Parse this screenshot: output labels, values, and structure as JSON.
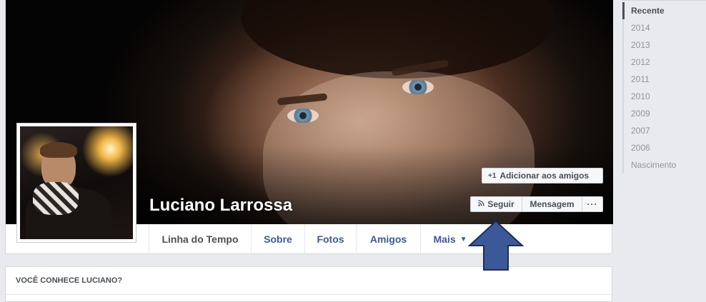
{
  "profile": {
    "name": "Luciano Larrossa"
  },
  "actions": {
    "add_friend": "Adicionar aos amigos",
    "follow": "Seguir",
    "message": "Mensagem",
    "more": "···"
  },
  "tabs": [
    {
      "label": "Linha do Tempo",
      "active": true
    },
    {
      "label": "Sobre"
    },
    {
      "label": "Fotos"
    },
    {
      "label": "Amigos"
    },
    {
      "label": "Mais"
    }
  ],
  "section": {
    "title": "VOCÊ CONHECE LUCIANO?"
  },
  "timeline_nav": {
    "items": [
      {
        "label": "Recente",
        "active": true
      },
      {
        "label": "2014"
      },
      {
        "label": "2013"
      },
      {
        "label": "2012"
      },
      {
        "label": "2011"
      },
      {
        "label": "2010"
      },
      {
        "label": "2009"
      },
      {
        "label": "2007"
      },
      {
        "label": "2006"
      },
      {
        "label": "Nascimento"
      }
    ]
  },
  "colors": {
    "link_blue": "#3b5998",
    "arrow_fill": "#3b5998",
    "page_bg": "#e9eaed"
  },
  "icons": {
    "add_friend": "add-friend-icon",
    "follow": "rss-icon",
    "more_caret": "caret-down-icon"
  }
}
